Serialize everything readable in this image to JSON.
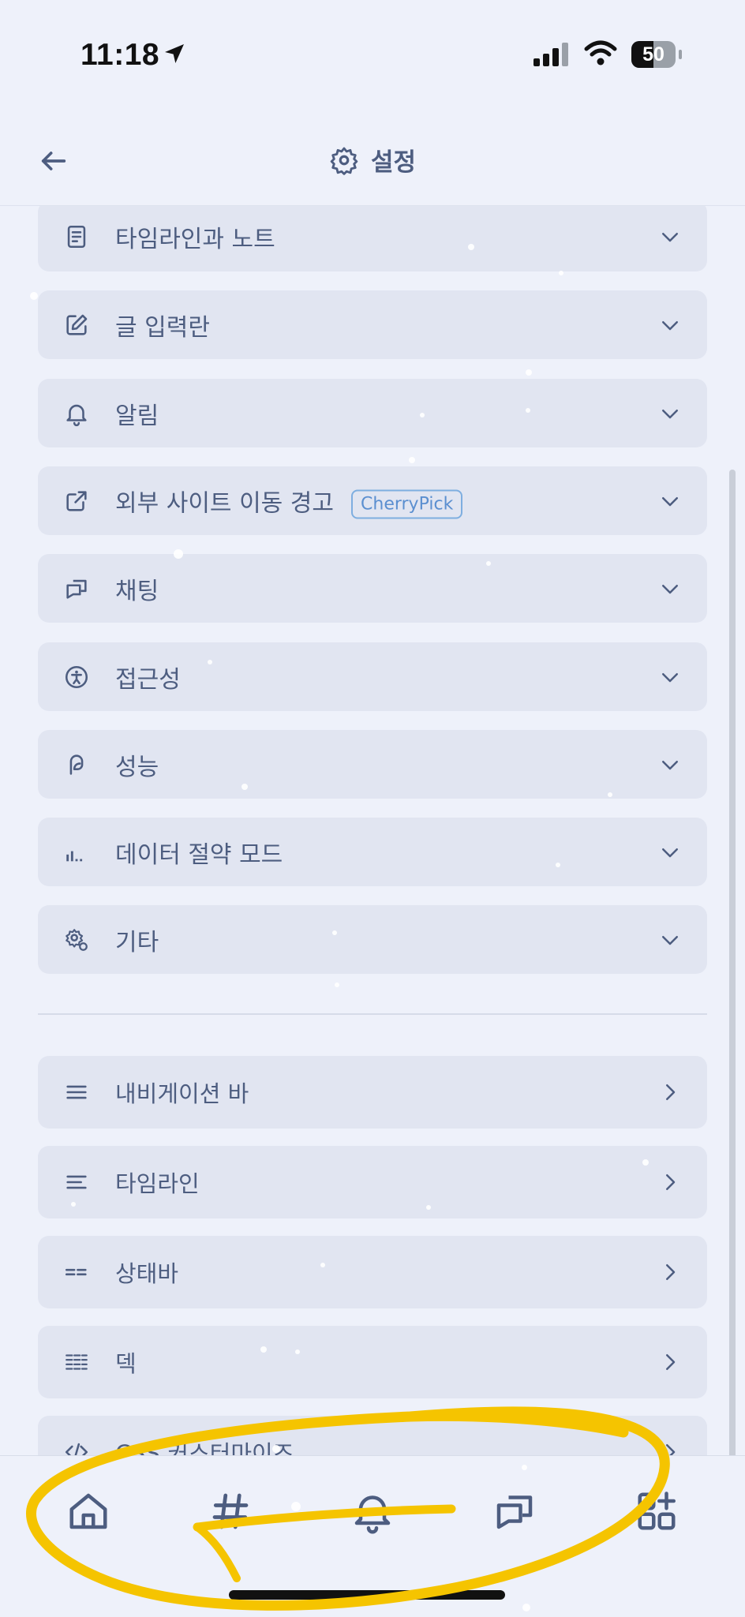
{
  "status_bar": {
    "time": "11:18",
    "battery": "50"
  },
  "header": {
    "title": "설정"
  },
  "sections": [
    {
      "label": "타임라인과 노트",
      "icon": "document-icon"
    },
    {
      "label": "글 입력란",
      "icon": "edit-icon"
    },
    {
      "label": "알림",
      "icon": "bell-icon"
    },
    {
      "label": "외부 사이트 이동 경고",
      "icon": "external-link-icon",
      "badge": "CherryPick"
    },
    {
      "label": "채팅",
      "icon": "chat-icon"
    },
    {
      "label": "접근성",
      "icon": "accessibility-icon"
    },
    {
      "label": "성능",
      "icon": "performance-icon"
    },
    {
      "label": "데이터 절약 모드",
      "icon": "signal-icon"
    },
    {
      "label": "기타",
      "icon": "settings-cog-icon"
    }
  ],
  "nav_items": [
    {
      "label": "내비게이션 바",
      "icon": "menu-icon"
    },
    {
      "label": "타임라인",
      "icon": "align-left-icon"
    },
    {
      "label": "상태바",
      "icon": "equals-icon"
    },
    {
      "label": "덱",
      "icon": "columns-icon"
    },
    {
      "label": "CSS 커스터마이즈",
      "icon": "code-icon"
    }
  ],
  "tabs": [
    {
      "name": "home",
      "icon": "home-icon"
    },
    {
      "name": "hashtag",
      "icon": "hashtag-icon"
    },
    {
      "name": "notifications",
      "icon": "bell-icon"
    },
    {
      "name": "chat",
      "icon": "chat-icon"
    },
    {
      "name": "widgets",
      "icon": "apps-add-icon"
    }
  ],
  "colors": {
    "background": "#eef1fa",
    "row": "#e1e5f1",
    "text": "#4d5d80",
    "badge": "#5b8fd0",
    "highlight": "#f5c400"
  }
}
